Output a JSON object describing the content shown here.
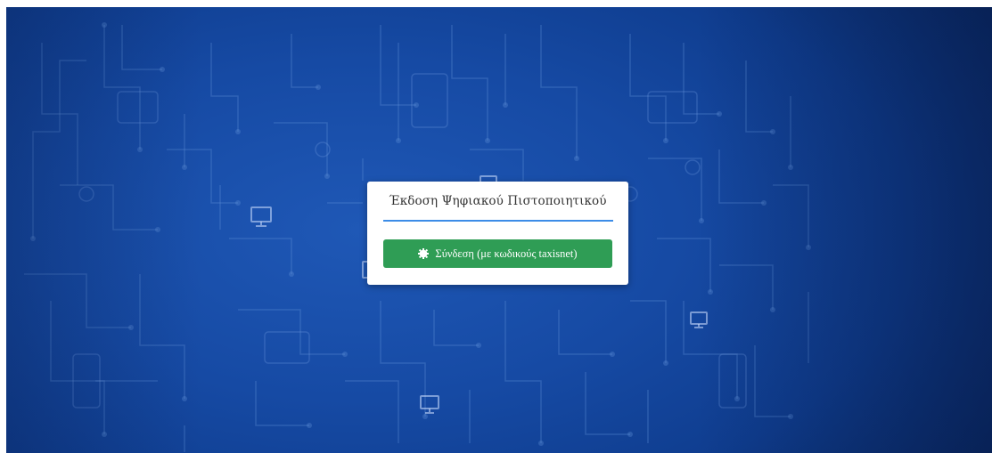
{
  "dialog": {
    "title": "Έκδοση Ψηφιακού Πιστοποιητικού",
    "login_button_label": "Σύνδεση (με κωδικούς taxisnet)",
    "login_button_icon": "cog-icon"
  },
  "colors": {
    "background_blue": "#164aa4",
    "title_underline": "#3c8ce7",
    "button_green": "#2f9d55",
    "card_background": "#ffffff"
  }
}
